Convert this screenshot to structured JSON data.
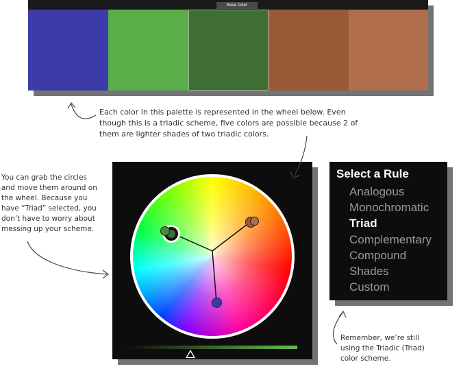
{
  "palette": {
    "label": "Base Color",
    "swatches": [
      {
        "color": "#3b3caa"
      },
      {
        "color": "#5aad48"
      },
      {
        "color": "#3e6e34",
        "selected": true
      },
      {
        "color": "#9a5a37"
      },
      {
        "color": "#b06e4c"
      }
    ]
  },
  "rules": {
    "title": "Select a Rule",
    "items": [
      "Analogous",
      "Monochromatic",
      "Triad",
      "Complementary",
      "Compound",
      "Shades",
      "Custom"
    ],
    "selected": "Triad"
  },
  "annotations": {
    "top_note_lines": [
      "Each color in this palette is represented in the wheel below. Even",
      "though this is a triadic scheme, five colors are possible because 2 of",
      "them are lighter shades of two triadic colors."
    ],
    "left_note_lines": [
      "You can grab the circles",
      "and move them around on",
      "the wheel. Because you",
      "have “Triad” selected, you",
      "don’t have to worry about",
      "messing up your scheme."
    ],
    "bottom_note_lines": [
      "Remember, we’re still",
      "using the Triadic (Triad)",
      "color scheme."
    ]
  },
  "colors": {
    "handle_green": "#3e6e34",
    "handle_orange": "#9a5a37",
    "handle_blue": "#3b3caa"
  }
}
